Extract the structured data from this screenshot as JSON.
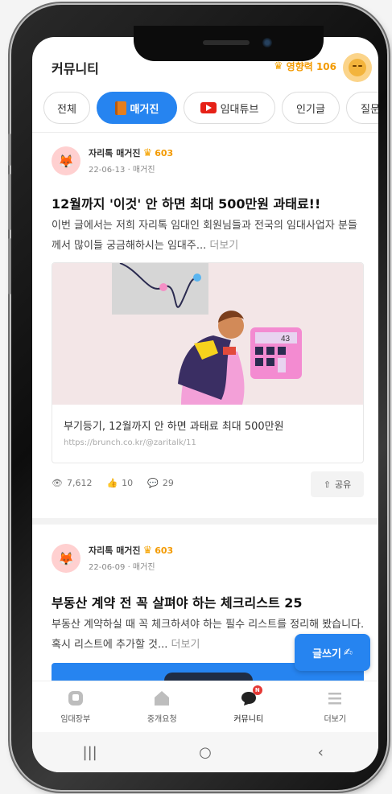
{
  "header": {
    "title": "커뮤니티",
    "influence_label": "영향력 106"
  },
  "tabs": [
    {
      "label": "전체"
    },
    {
      "label": "매거진"
    },
    {
      "label": "임대튜브"
    },
    {
      "label": "인기글"
    },
    {
      "label": "질문"
    }
  ],
  "posts": [
    {
      "author": "자리톡 매거진",
      "score": "603",
      "date": "22-06-13 · 매거진",
      "title": "12월까지 '이것' 안 하면 최대 500만원 과태료!!",
      "body": "이번 글에서는 저희 자리톡 임대인 회원님들과 전국의 임대사업자 분들께서 많이들 궁금해하시는 임대주...",
      "more": "더보기",
      "link": {
        "title": "부기등기, 12월까지 안 하면 과태료 최대 500만원",
        "url": "https://brunch.co.kr/@zaritalk/11",
        "calc_number": "43"
      },
      "views": "7,612",
      "likes": "10",
      "comments": "29",
      "share_label": "공유"
    },
    {
      "author": "자리톡 매거진",
      "score": "603",
      "date": "22-06-09 · 매거진",
      "title": "부동산 계약 전 꼭 살펴야 하는 체크리스트 25",
      "body": "부동산 계약하실 때 꼭 체크하셔야 하는 필수 리스트를 정리해 봤습니다. 혹시 리스트에 추가할 것...",
      "more": "더보기"
    }
  ],
  "write_button": "글쓰기",
  "bottom_nav": [
    {
      "label": "임대장부",
      "icon": "ledger-icon"
    },
    {
      "label": "중개요청",
      "icon": "home-icon"
    },
    {
      "label": "커뮤니티",
      "icon": "chat-icon",
      "badge": "N"
    },
    {
      "label": "더보기",
      "icon": "menu-icon"
    }
  ],
  "colors": {
    "accent": "#2684f0",
    "influence": "#f39a00"
  }
}
